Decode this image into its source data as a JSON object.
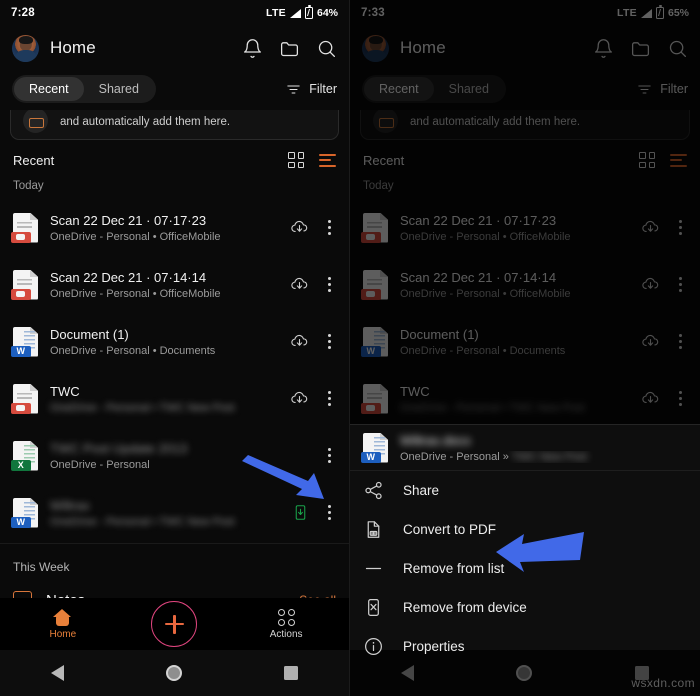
{
  "left": {
    "status": {
      "time": "7:28",
      "network": "LTE",
      "battery": "64%"
    },
    "appbar": {
      "title": "Home",
      "avatar_name": "user-avatar",
      "icons": [
        "bell-icon",
        "folder-icon",
        "search-icon"
      ]
    },
    "tabs": {
      "recent": "Recent",
      "shared": "Shared",
      "filter": "Filter"
    },
    "promo": {
      "text": "and automatically add them here."
    },
    "section": {
      "title": "Recent",
      "day": "Today"
    },
    "files": [
      {
        "name": "Scan 22 Dec 21 · 07·17·23",
        "sub": "OneDrive - Personal • OfficeMobile",
        "type": "pdf",
        "blurred_name": false,
        "blurred_sub": false,
        "action": "cloud"
      },
      {
        "name": "Scan 22 Dec 21 · 07·14·14",
        "sub": "OneDrive - Personal • OfficeMobile",
        "type": "pdf",
        "blurred_name": false,
        "blurred_sub": false,
        "action": "cloud"
      },
      {
        "name": "Document (1)",
        "sub": "OneDrive - Personal • Documents",
        "type": "word",
        "blurred_name": false,
        "blurred_sub": false,
        "action": "cloud"
      },
      {
        "name": "TWC",
        "sub": "OneDrive - Personal • TWC New Post",
        "type": "pdf",
        "blurred_name": false,
        "blurred_sub": true,
        "action": "cloud"
      },
      {
        "name": "TWC Post Update 2013",
        "sub": "OneDrive - Personal",
        "type": "excel",
        "blurred_name": true,
        "blurred_sub": false,
        "action": "none"
      },
      {
        "name": "Wiltrax",
        "sub": "OneDrive - Personal • TWC New Post",
        "type": "word",
        "blurred_name": true,
        "blurred_sub": true,
        "action": "device"
      }
    ],
    "notes": {
      "week_label": "This Week",
      "title": "Notes",
      "see_all": "See all"
    },
    "bottomnav": {
      "home": "Home",
      "actions": "Actions",
      "fab": "add-button"
    }
  },
  "right": {
    "status": {
      "time": "7:33",
      "network": "LTE",
      "battery": "65%"
    },
    "appbar": {
      "title": "Home"
    },
    "tabs": {
      "recent": "Recent",
      "shared": "Shared",
      "filter": "Filter"
    },
    "promo": {
      "text": "and automatically add them here."
    },
    "section": {
      "title": "Recent",
      "day": "Today"
    },
    "files": [
      {
        "name": "Scan 22 Dec 21 · 07·17·23",
        "sub": "OneDrive - Personal • OfficeMobile",
        "type": "pdf",
        "blurred_name": false,
        "blurred_sub": false,
        "action": "cloud"
      },
      {
        "name": "Scan 22 Dec 21 · 07·14·14",
        "sub": "OneDrive - Personal • OfficeMobile",
        "type": "pdf",
        "blurred_name": false,
        "blurred_sub": false,
        "action": "cloud"
      },
      {
        "name": "Document (1)",
        "sub": "OneDrive - Personal • Documents",
        "type": "word",
        "blurred_name": false,
        "blurred_sub": false,
        "action": "cloud"
      },
      {
        "name": "TWC",
        "sub": "OneDrive - Personal • TWC New Post",
        "type": "pdf",
        "blurred_name": false,
        "blurred_sub": true,
        "action": "cloud"
      }
    ],
    "sheet": {
      "file": {
        "name": "Wiltrax.docx",
        "sub": "OneDrive - Personal » TWC New Post",
        "type": "word"
      },
      "items": [
        {
          "label": "Share",
          "icon": "share-icon"
        },
        {
          "label": "Convert to PDF",
          "icon": "convert-pdf-icon"
        },
        {
          "label": "Remove from list",
          "icon": "minus-icon"
        },
        {
          "label": "Remove from device",
          "icon": "remove-device-icon"
        },
        {
          "label": "Properties",
          "icon": "info-icon"
        }
      ]
    }
  },
  "watermark": "wsxdn.com",
  "colors": {
    "accent_orange": "#e8803a",
    "accent_pink": "#e0457f",
    "arrow_blue": "#4169e8",
    "device_green": "#19a24a",
    "note_yellow": "#f2e6a4"
  }
}
